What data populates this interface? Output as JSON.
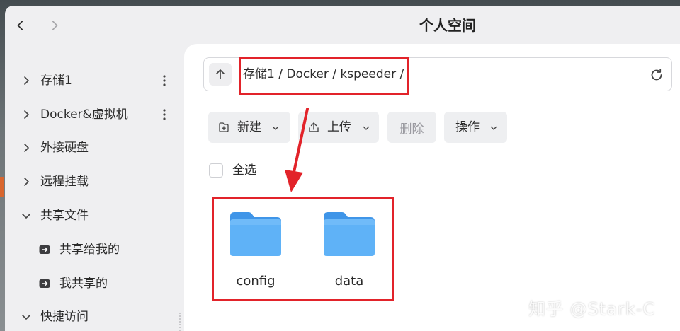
{
  "window": {
    "title": "个人空间"
  },
  "sidebar": {
    "items": [
      {
        "label": "存储1",
        "expanded": false,
        "has_menu": true
      },
      {
        "label": "Docker&虚拟机",
        "expanded": false,
        "has_menu": true
      },
      {
        "label": "外接硬盘",
        "expanded": false,
        "has_menu": false
      },
      {
        "label": "远程挂载",
        "expanded": false,
        "has_menu": false
      },
      {
        "label": "共享文件",
        "expanded": true,
        "has_menu": false
      },
      {
        "label": "快捷访问",
        "expanded": true,
        "has_menu": false
      }
    ],
    "subitems": [
      {
        "label": "共享给我的",
        "icon": "share-folder-icon"
      },
      {
        "label": "我共享的",
        "icon": "share-folder-icon"
      }
    ]
  },
  "pathbar": {
    "path": "存储1 / Docker / kspeeder /"
  },
  "toolbar": {
    "new_label": "新建",
    "upload_label": "上传",
    "delete_label": "删除",
    "ops_label": "操作"
  },
  "select_all": {
    "label": "全选"
  },
  "files": [
    {
      "name": "config",
      "type": "folder"
    },
    {
      "name": "data",
      "type": "folder"
    }
  ],
  "watermark": "知乎 @Stark-C",
  "colors": {
    "folder_blue": "#4ea6f5",
    "highlight_red": "#e2232a",
    "window_bg": "#efeff1"
  }
}
